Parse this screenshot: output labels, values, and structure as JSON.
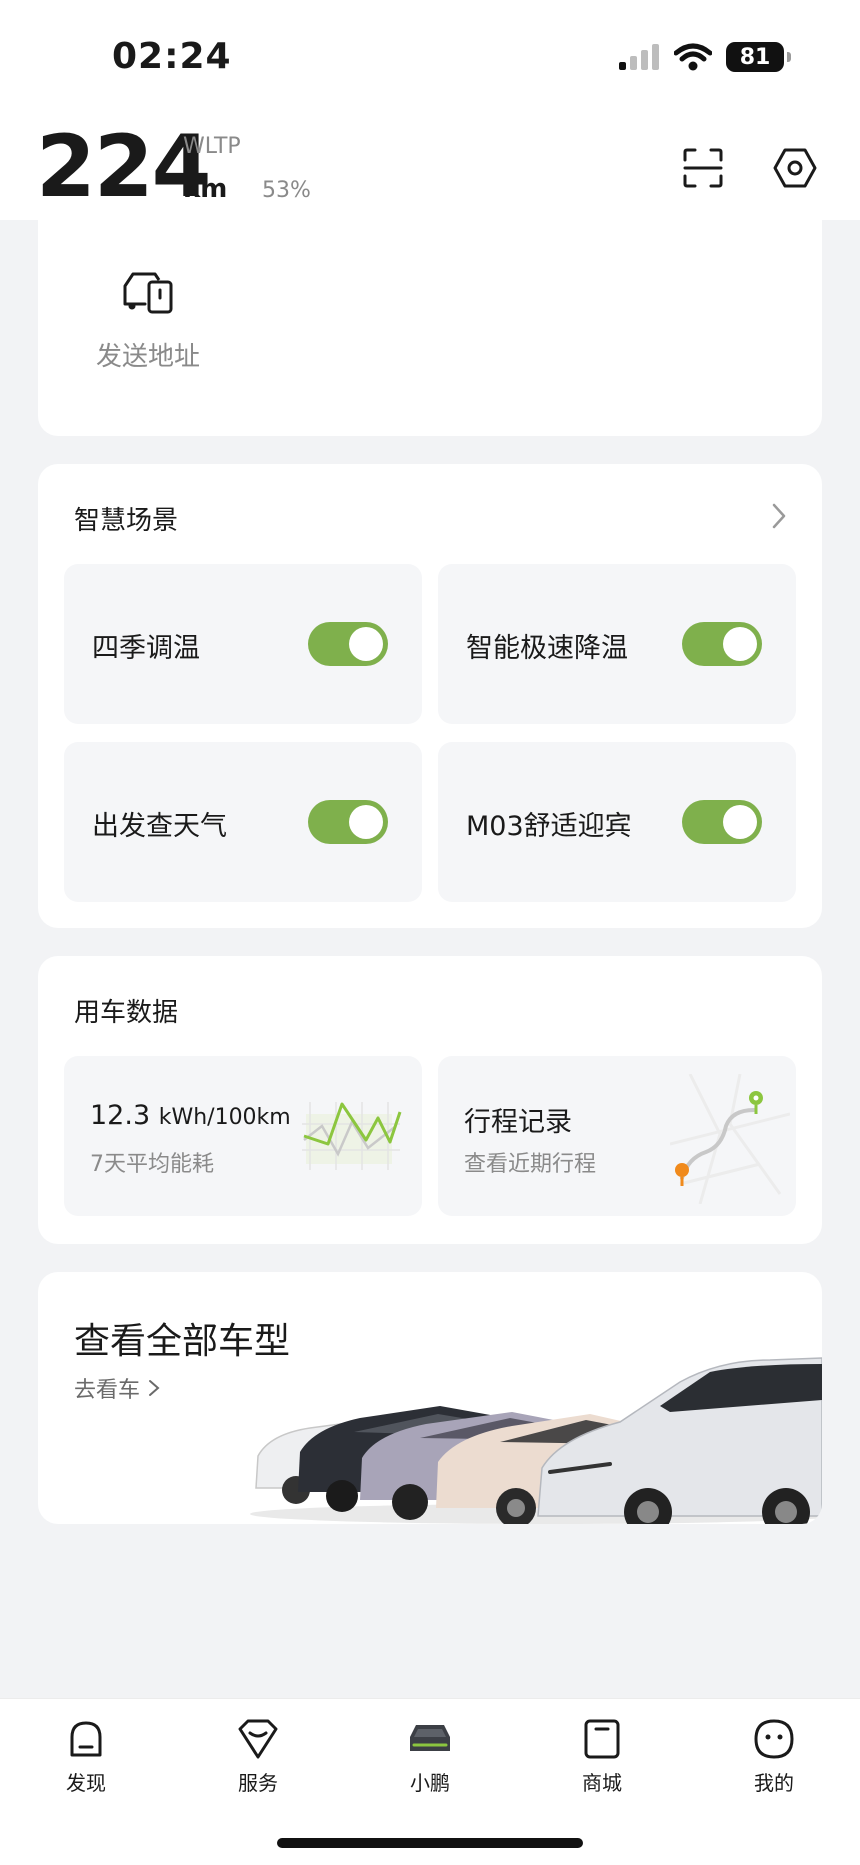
{
  "status_bar": {
    "time": "02:24",
    "battery": "81"
  },
  "header": {
    "range_value": "224",
    "range_standard": "WLTP",
    "range_unit": "km",
    "battery_percent": "53%"
  },
  "send_address": {
    "label": "发送地址"
  },
  "smart_scenes": {
    "title": "智慧场景",
    "items": [
      {
        "label": "四季调温",
        "enabled": true
      },
      {
        "label": "智能极速降温",
        "enabled": true
      },
      {
        "label": "出发查天气",
        "enabled": true
      },
      {
        "label": "M03舒适迎宾",
        "enabled": true
      }
    ]
  },
  "usage_data": {
    "title": "用车数据",
    "energy": {
      "value": "12.3",
      "unit": "kWh/100km",
      "caption": "7天平均能耗"
    },
    "trips": {
      "title": "行程记录",
      "caption": "查看近期行程"
    }
  },
  "all_models": {
    "title": "查看全部车型",
    "link": "去看车"
  },
  "tabs": [
    {
      "label": "发现",
      "icon": "discover-icon",
      "active": false
    },
    {
      "label": "服务",
      "icon": "service-icon",
      "active": false
    },
    {
      "label": "小鹏",
      "icon": "car-icon",
      "active": true
    },
    {
      "label": "商城",
      "icon": "shop-icon",
      "active": false
    },
    {
      "label": "我的",
      "icon": "profile-icon",
      "active": false
    }
  ],
  "colors": {
    "accent_green": "#7fb04c",
    "background": "#f2f3f5",
    "card": "#ffffff"
  }
}
